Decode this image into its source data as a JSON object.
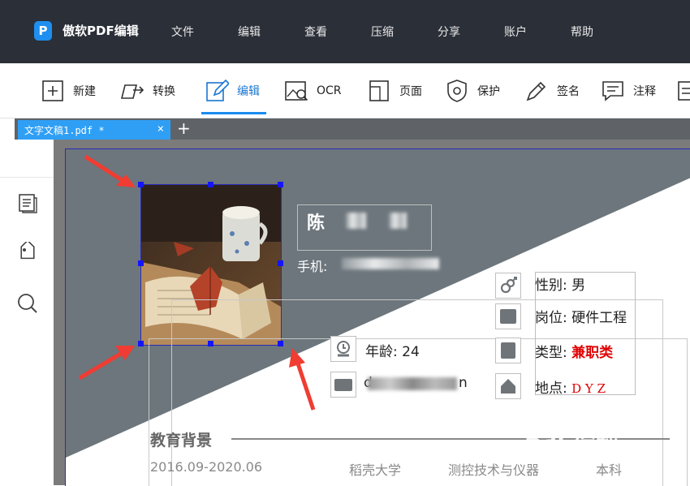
{
  "app": {
    "logo_glyph": "P",
    "name": "傲软PDF编辑"
  },
  "menu": [
    "文件",
    "编辑",
    "查看",
    "压缩",
    "分享",
    "账户",
    "帮助"
  ],
  "toolbar": {
    "new": "新建",
    "convert": "转换",
    "edit": "编辑",
    "ocr": "OCR",
    "page": "页面",
    "protect": "保护",
    "sign": "签名",
    "annotate": "注释"
  },
  "tab": {
    "title": "文字文稿1.pdf *",
    "close": "×",
    "add": "+"
  },
  "resume": {
    "name": "陈",
    "phone_label": "手机:",
    "gender": "性别: 男",
    "position": "岗位: 硬件工程",
    "age": "年龄: 24",
    "type_label": "类型: ",
    "type_value": "兼职类",
    "location_label": "地点: ",
    "location_value": "D Y Z",
    "email_partial": "d",
    "email_tail": "n",
    "education_heading": "教育背景",
    "edu_period": "2016.09-2020.06",
    "edu_school": "稻壳大学",
    "edu_major": "测控技术与仪器",
    "edu_degree": "本科"
  },
  "watermark": {
    "text": "Bai 经验",
    "sub": "jingyan.baidu.com"
  },
  "colors": {
    "accent": "#1a8cf0",
    "title_bar": "#2b2f38",
    "highlight_red": "#e00000",
    "page_gray": "#6c767c"
  }
}
